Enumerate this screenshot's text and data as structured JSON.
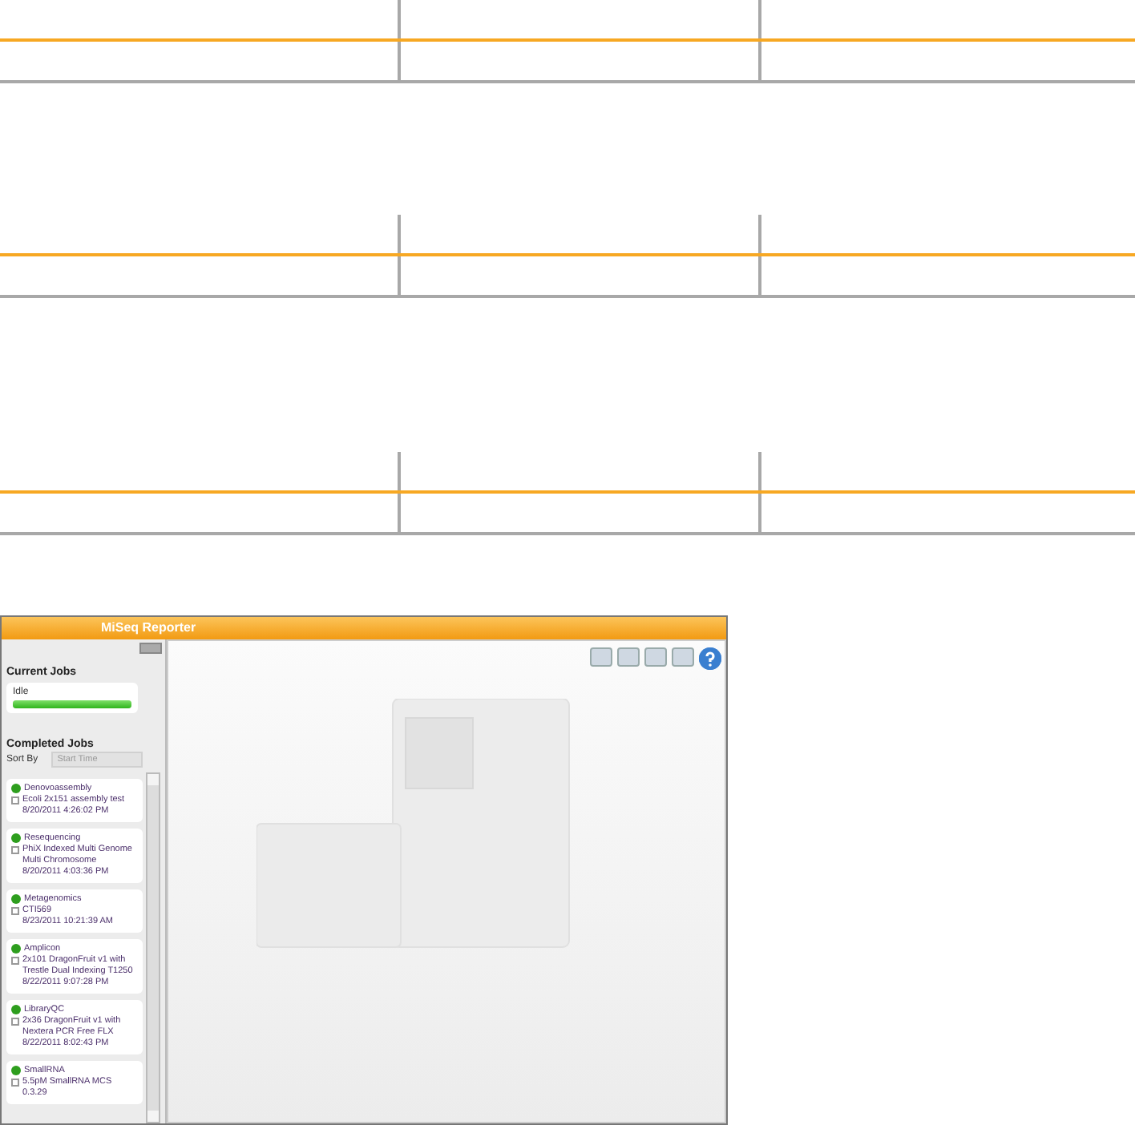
{
  "window": {
    "title": "MiSeq Reporter"
  },
  "current_jobs": {
    "heading": "Current Jobs",
    "job": {
      "status": "Idle",
      "level": 1
    }
  },
  "completed_jobs": {
    "heading": "Completed Jobs",
    "sort_label": "Sort By",
    "sort_value": "Start Time",
    "items": [
      {
        "type": "Denovoassembly",
        "color": "#2e9e1e",
        "name": "Ecoli 2x151 assembly test",
        "date": "8/20/2011 4:26:02 PM"
      },
      {
        "type": "Resequencing",
        "color": "#2e9e1e",
        "name": "PhiX Indexed Multi Genome Multi Chromosome",
        "date": "8/20/2011 4:03:36 PM"
      },
      {
        "type": "Metagenomics",
        "color": "#2e9e1e",
        "name": "CTI569",
        "date": "8/23/2011 10:21:39 AM"
      },
      {
        "type": "Amplicon",
        "color": "#2e9e1e",
        "name": "2x101 DragonFruit v1 with Trestle Dual Indexing T1250",
        "date": "8/22/2011 9:07:28 PM"
      },
      {
        "type": "LibraryQC",
        "color": "#2e9e1e",
        "name": "2x36 DragonFruit v1 with Nextera PCR Free FLX",
        "date": "8/22/2011 8:02:43 PM"
      },
      {
        "type": "SmallRNA",
        "color": "#2e9e1e",
        "name": "5.5pM SmallRNA MCS 0.3.29"
      }
    ]
  }
}
